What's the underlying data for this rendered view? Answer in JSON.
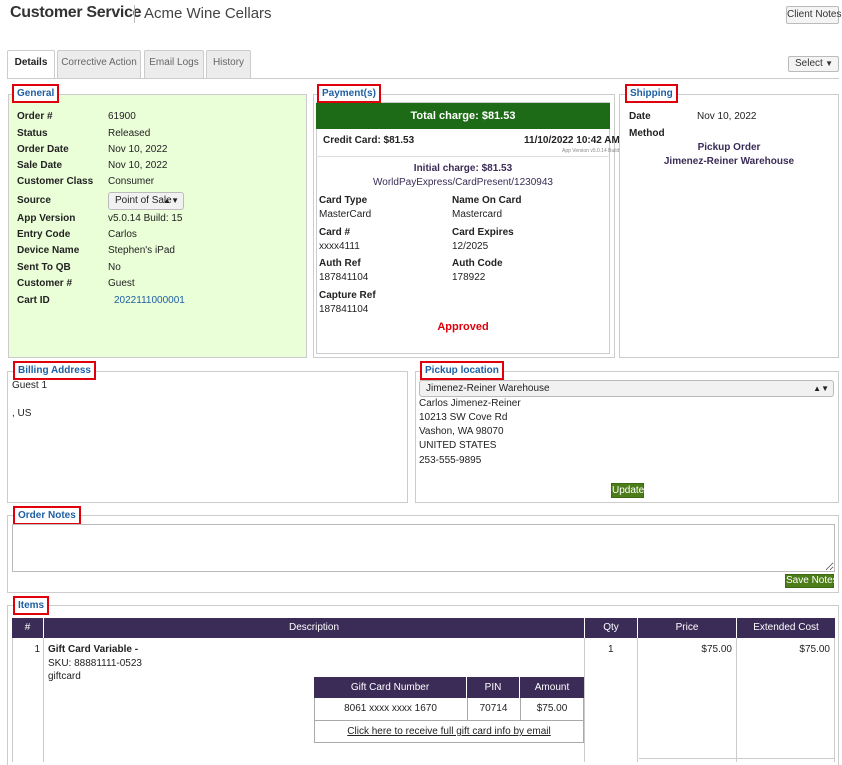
{
  "header": {
    "title": "Customer Service",
    "subtitle": "Acme Wine Cellars",
    "client_notes": "Client Notes"
  },
  "tabs": [
    {
      "label": "Details",
      "active": true
    },
    {
      "label": "Corrective Action",
      "active": false
    },
    {
      "label": "Email Logs",
      "active": false
    },
    {
      "label": "History",
      "active": false
    }
  ],
  "select_menu": {
    "value": "Select"
  },
  "general": {
    "label": "General",
    "fields": {
      "order_no": {
        "label": "Order #",
        "value": "61900"
      },
      "status": {
        "label": "Status",
        "value": "Released"
      },
      "order_date": {
        "label": "Order Date",
        "value": "Nov 10, 2022"
      },
      "sale_date": {
        "label": "Sale Date",
        "value": "Nov 10, 2022"
      },
      "customer_class": {
        "label": "Customer Class",
        "value": "Consumer"
      },
      "source": {
        "label": "Source",
        "value": "Point of Sale"
      },
      "app_version": {
        "label": "App Version",
        "value": "v5.0.14 Build: 15"
      },
      "entry_code": {
        "label": "Entry Code",
        "value": "Carlos"
      },
      "device_name": {
        "label": "Device Name",
        "value": "Stephen's iPad"
      },
      "sent_to_qb": {
        "label": "Sent To QB",
        "value": "No"
      },
      "customer_no": {
        "label": "Customer #",
        "value": "Guest"
      },
      "cart_id": {
        "label": "Cart ID",
        "value": "2022111000001"
      }
    },
    "bg_color": "#eafed8"
  },
  "payment": {
    "label": "Payment(s)",
    "total_charge": "Total charge: $81.53",
    "card_line": "Credit Card: $81.53",
    "card_datetime": "11/10/2022 10:42 AM",
    "app_version_small": "App Version v5.0.14 Build 15",
    "initial_charge": "Initial charge: $81.53",
    "gateway": "WorldPayExpress/CardPresent/1230943",
    "card_type": {
      "label": "Card Type",
      "value": "MasterCard"
    },
    "name_on_card": {
      "label": "Name On Card",
      "value": "Mastercard"
    },
    "card_no": {
      "label": "Card #",
      "value": "xxxx4111"
    },
    "card_expires": {
      "label": "Card Expires",
      "value": "12/2025"
    },
    "auth_ref": {
      "label": "Auth Ref",
      "value": "187841104"
    },
    "auth_code": {
      "label": "Auth Code",
      "value": "178922"
    },
    "capture_ref": {
      "label": "Capture Ref",
      "value": "187841104"
    },
    "status": "Approved",
    "bar_color": "#1e6b17"
  },
  "shipping": {
    "label": "Shipping",
    "date_label": "Date",
    "date_value": "Nov 10, 2022",
    "method_label": "Method",
    "method_line1": "Pickup Order",
    "method_line2": "Jimenez-Reiner Warehouse"
  },
  "billing": {
    "label": "Billing Address",
    "line1": "Guest 1",
    "line2": ", US"
  },
  "pickup": {
    "label": "Pickup location",
    "selected": "Jimenez-Reiner Warehouse",
    "lines": [
      "Carlos Jimenez-Reiner",
      "10213 SW Cove Rd",
      "Vashon, WA 98070",
      "UNITED STATES",
      "253-555-9895"
    ],
    "update_button": "Update"
  },
  "order_notes": {
    "label": "Order Notes",
    "value": "",
    "save_button": "Save Notes"
  },
  "items": {
    "label": "Items",
    "columns": [
      "#",
      "Description",
      "Qty",
      "Price",
      "Extended Cost"
    ],
    "rows": [
      {
        "num": "1",
        "name": "Gift Card Variable -",
        "sku": "SKU: 88881111-0523",
        "type": "giftcard",
        "qty": "1",
        "price": "$75.00",
        "extended": "$75.00"
      }
    ],
    "giftcard": {
      "columns": [
        "Gift Card Number",
        "PIN",
        "Amount"
      ],
      "number": "8061 xxxx xxxx 1670",
      "pin": "70714",
      "amount": "$75.00",
      "email_link": "Click here to receive full gift card info by email"
    },
    "header_color": "#3a2c56"
  }
}
